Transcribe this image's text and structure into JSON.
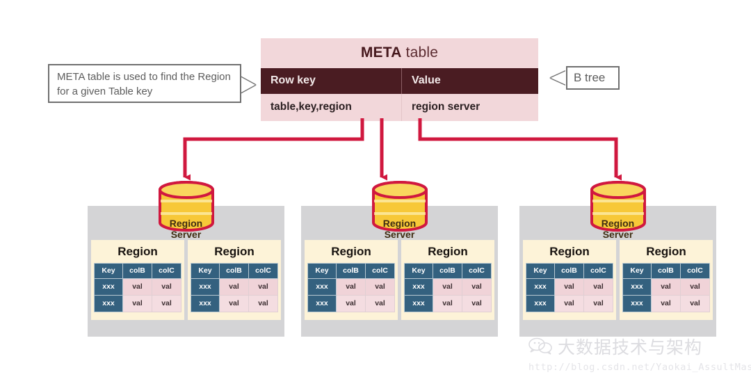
{
  "meta_table": {
    "title_bold": "META",
    "title_rest": " table",
    "headers": [
      "Row key",
      "Value"
    ],
    "row": [
      "table,key,region",
      "region server"
    ]
  },
  "callouts": {
    "left": "META table is used to find the Region for a given Table key",
    "right": "B tree"
  },
  "region_table_headers": [
    "Key",
    "colB",
    "colC"
  ],
  "region_table_rows": [
    [
      "xxx",
      "val",
      "val"
    ],
    [
      "xxx",
      "val",
      "val"
    ]
  ],
  "groups": [
    {
      "server_line1": "Region",
      "server_line2": "Server",
      "regions": [
        {
          "title": "Region"
        },
        {
          "title": "Region"
        }
      ]
    },
    {
      "server_line1": "Region",
      "server_line2": "Server",
      "regions": [
        {
          "title": "Region"
        },
        {
          "title": "Region"
        }
      ]
    },
    {
      "server_line1": "Region",
      "server_line2": "Server",
      "regions": [
        {
          "title": "Region"
        },
        {
          "title": "Region"
        }
      ]
    }
  ],
  "watermark": {
    "name": "大数据技术与架构",
    "url": "http://blog.csdn.net/Yaokai_AssultMaster"
  },
  "colors": {
    "meta_header": "#4a1c22",
    "meta_body": "#f2d7da",
    "arrow": "#d0183f",
    "cylinder_fill": "#f7c838",
    "cylinder_stroke": "#d0183f",
    "group_bg": "#d4d4d6",
    "region_bg": "#fdf3d8",
    "key_cell": "#34617f",
    "val_cell": "#f0d3d8"
  }
}
